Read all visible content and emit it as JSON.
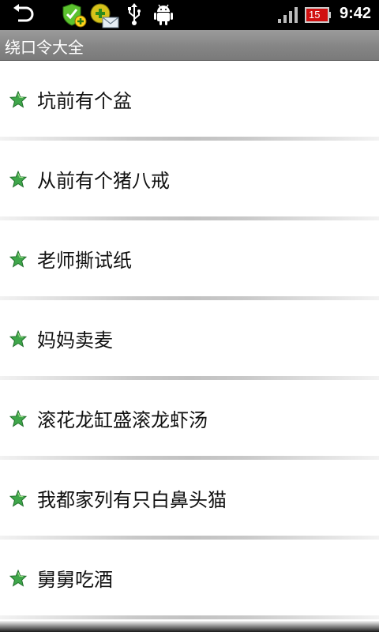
{
  "statusbar": {
    "battery_level": "15",
    "time": "9:42",
    "icons": [
      "back-icon",
      "shield-plus-icon",
      "message-icon",
      "usb-icon",
      "android-icon",
      "signal-icon",
      "battery-icon"
    ]
  },
  "titlebar": {
    "title": "绕口令大全"
  },
  "list": {
    "items": [
      {
        "label": "坑前有个盆"
      },
      {
        "label": "从前有个猪八戒"
      },
      {
        "label": "老师撕试纸"
      },
      {
        "label": "妈妈卖麦"
      },
      {
        "label": "滚花龙缸盛滚龙虾汤"
      },
      {
        "label": "我都家列有只白鼻头猫"
      },
      {
        "label": "舅舅吃酒"
      }
    ]
  },
  "colors": {
    "star_fill": "#3fa64a",
    "titlebar": "#8a8a8a"
  }
}
